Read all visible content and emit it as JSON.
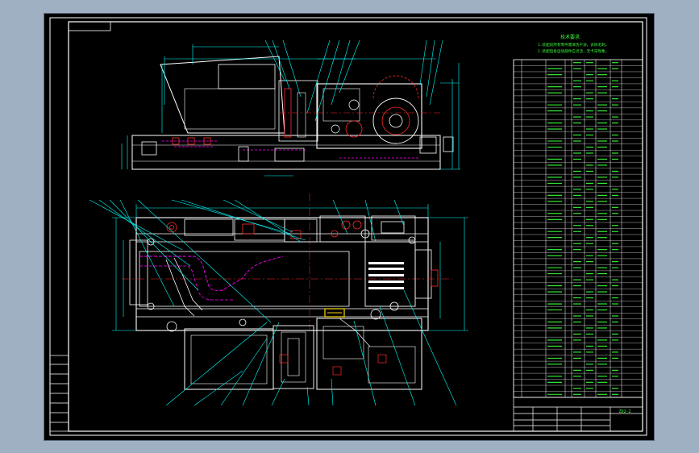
{
  "drawing": {
    "notes_title": "技术要求",
    "notes_lines": [
      "1.装配前所有零件需清洗干净，去除毛刺。",
      "2.装配后各运动部件应灵活，无卡滞现象。"
    ],
    "title_block_code": "ZD2-2"
  },
  "colors": {
    "background": "#000000",
    "frame": "#ffffff",
    "geometry": "#ffffff",
    "dimension": "#00ffff",
    "leader": "#00ffff",
    "hidden": "#ff00ff",
    "red_detail": "#ff2b2b",
    "table_text": "#39ff39",
    "yellow_detail": "#ffd800"
  }
}
